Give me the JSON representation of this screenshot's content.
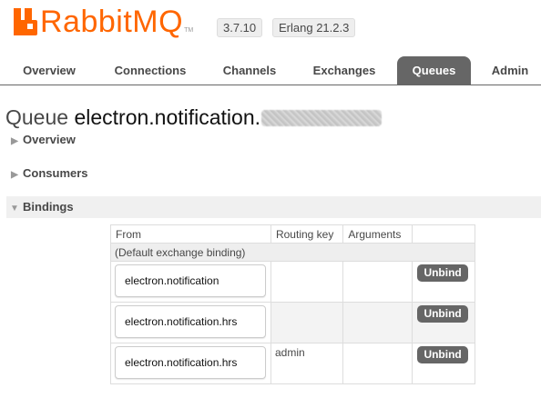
{
  "header": {
    "logo_text": "RabbitMQ",
    "logo_tm": "TM",
    "version": "3.7.10",
    "erlang": "Erlang 21.2.3"
  },
  "tabs": [
    {
      "label": "Overview",
      "active": false
    },
    {
      "label": "Connections",
      "active": false
    },
    {
      "label": "Channels",
      "active": false
    },
    {
      "label": "Exchanges",
      "active": false
    },
    {
      "label": "Queues",
      "active": true
    },
    {
      "label": "Admin",
      "active": false
    }
  ],
  "page": {
    "title_prefix": "Queue ",
    "queue_name": "electron.notification."
  },
  "sections": {
    "overview": "Overview",
    "consumers": "Consumers",
    "bindings": "Bindings"
  },
  "bindings_table": {
    "headers": [
      "From",
      "Routing key",
      "Arguments",
      ""
    ],
    "default_row": "(Default exchange binding)",
    "rows": [
      {
        "from": "electron.notification",
        "routing_key": "",
        "arguments": "",
        "action": "Unbind"
      },
      {
        "from": "electron.notification.hrs",
        "routing_key": "",
        "arguments": "",
        "action": "Unbind"
      },
      {
        "from": "electron.notification.hrs",
        "routing_key": "admin",
        "arguments": "",
        "action": "Unbind"
      }
    ]
  },
  "colors": {
    "brand": "#ff6600",
    "active_tab": "#666666",
    "button": "#666666"
  }
}
